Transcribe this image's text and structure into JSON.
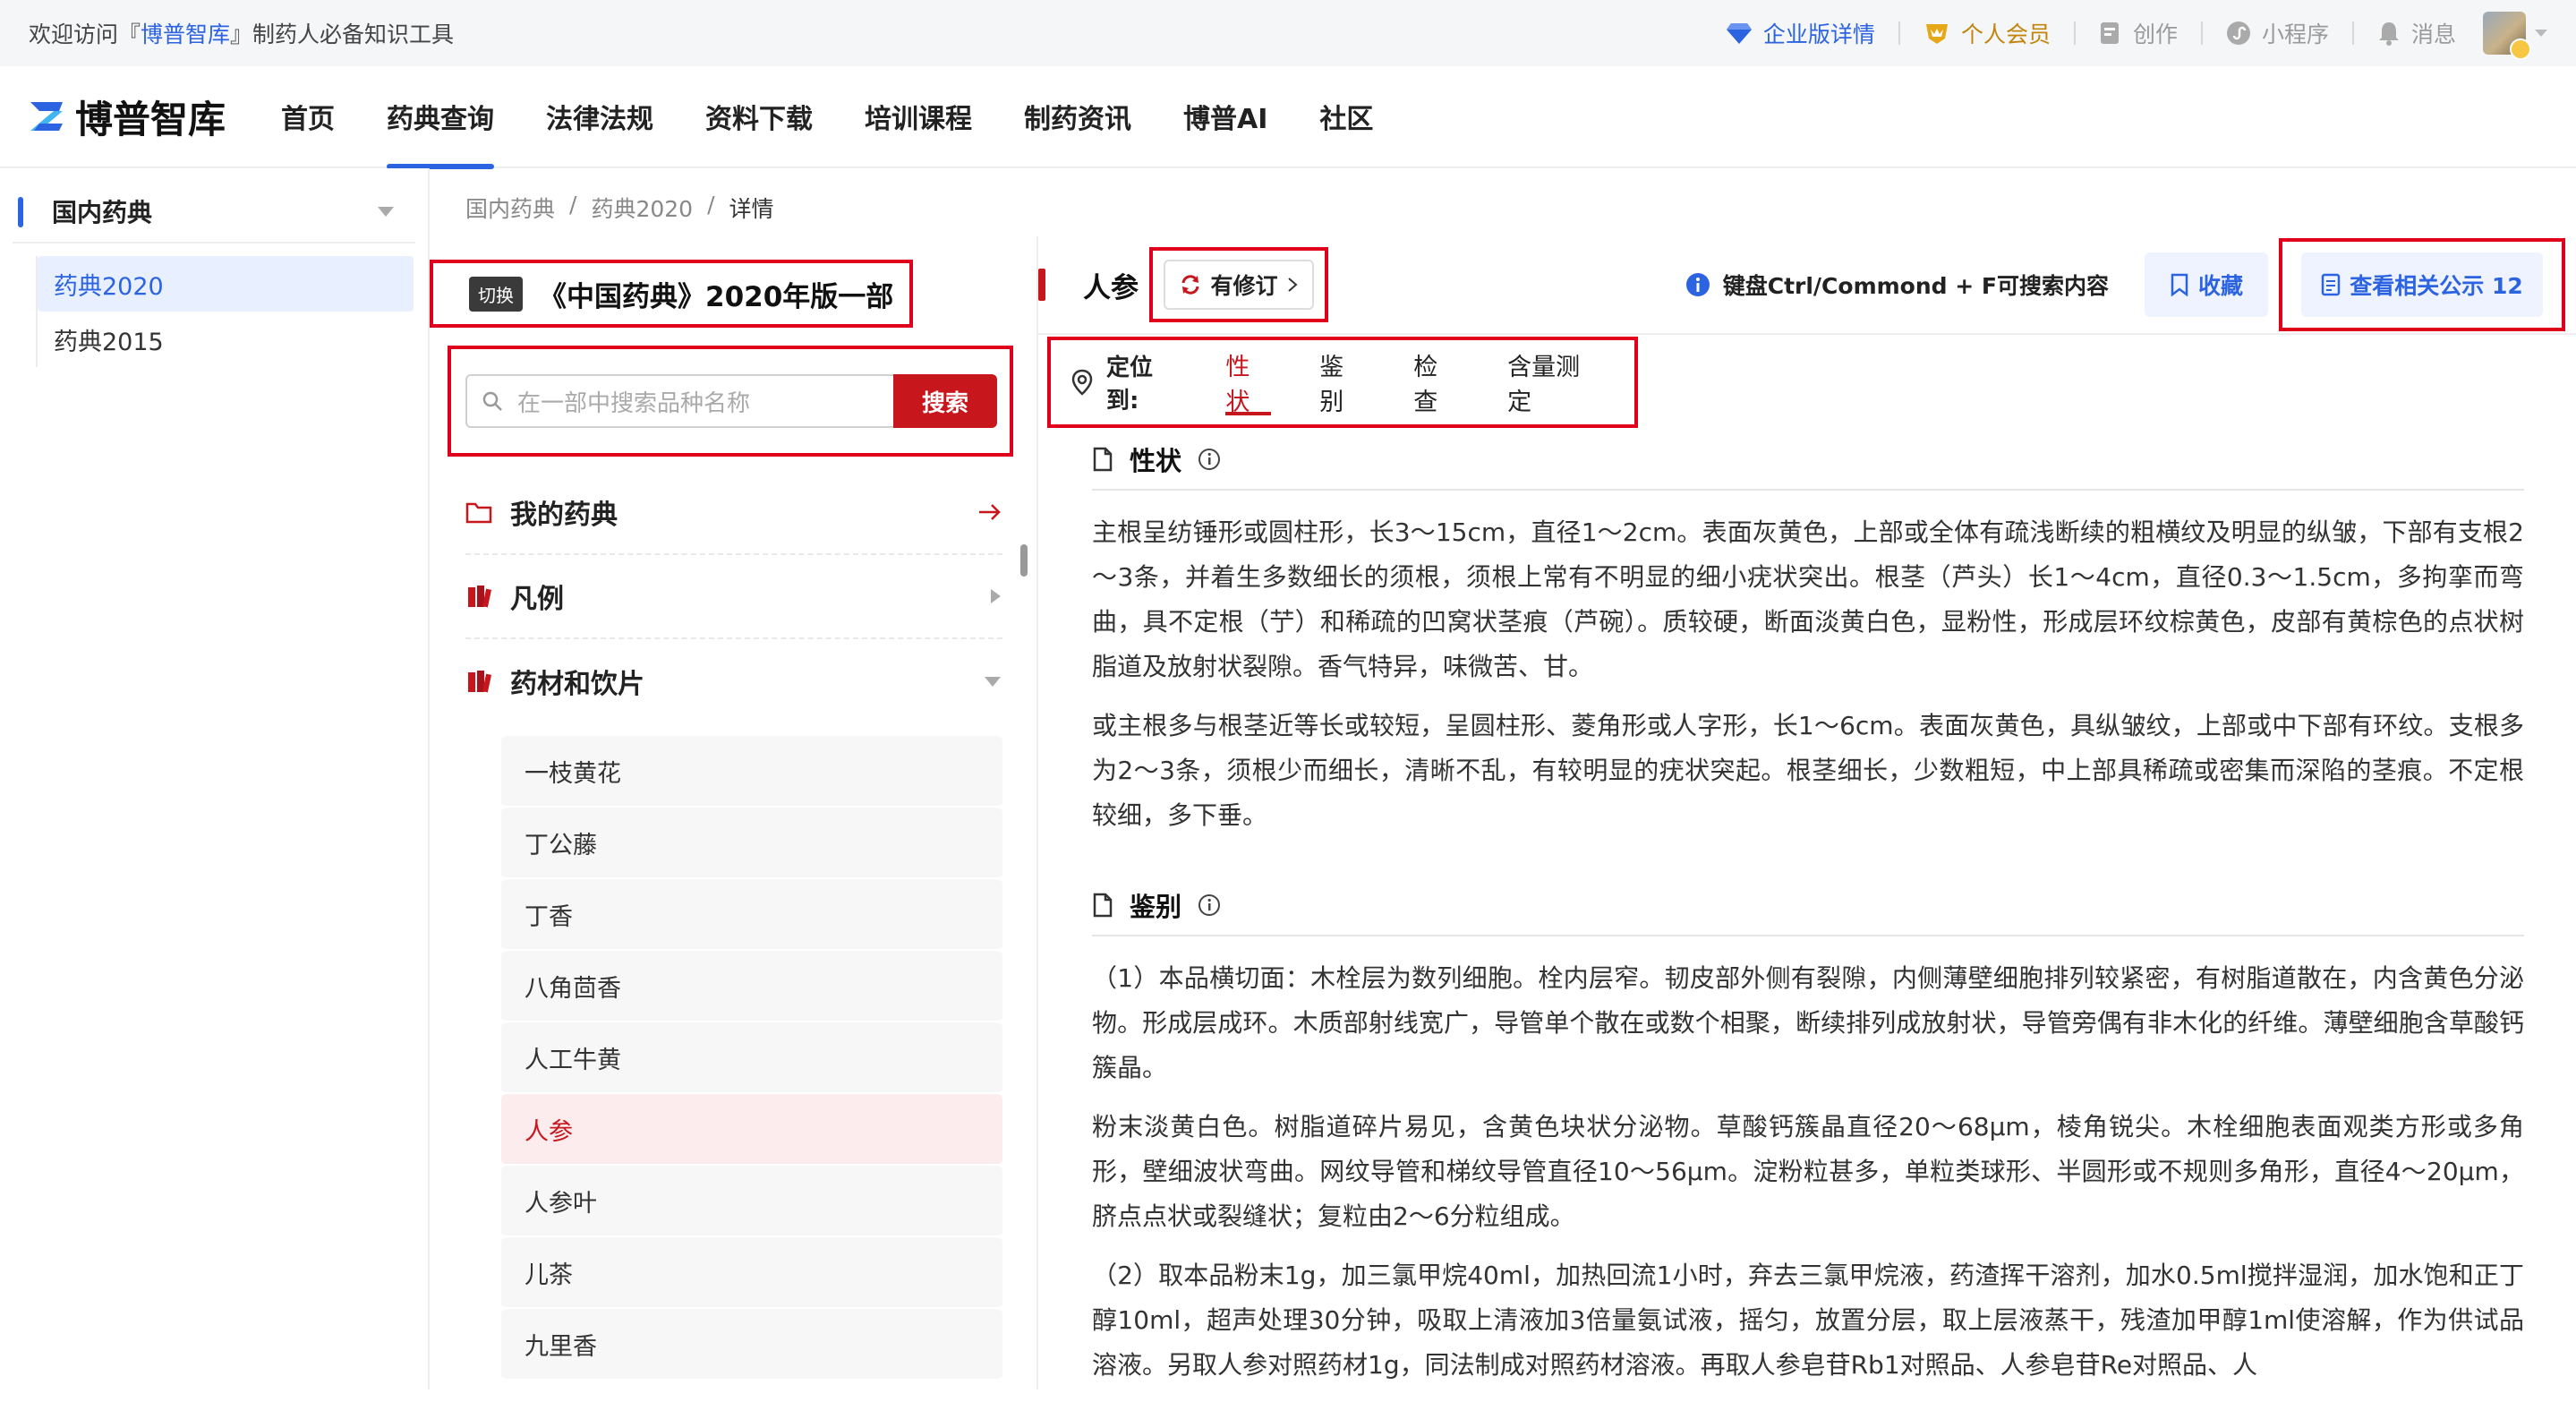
{
  "topbar": {
    "welcome_prefix": "欢迎访问『",
    "brand": "博普智库",
    "welcome_suffix": "』制药人必备知识工具",
    "items": [
      {
        "label": "企业版详情",
        "icon": "diamond-icon"
      },
      {
        "label": "个人会员",
        "icon": "crown-badge-icon"
      },
      {
        "label": "创作",
        "icon": "edit-doc-icon"
      },
      {
        "label": "小程序",
        "icon": "mini-program-icon"
      },
      {
        "label": "消息",
        "icon": "bell-icon"
      }
    ]
  },
  "nav": {
    "logo": "博普智库",
    "items": [
      "首页",
      "药典查询",
      "法律法规",
      "资料下载",
      "培训课程",
      "制药资讯",
      "博普AI",
      "社区"
    ],
    "active": "药典查询"
  },
  "sidebar": {
    "group": "国内药典",
    "items": [
      "药典2020",
      "药典2015"
    ],
    "active": "药典2020"
  },
  "breadcrumb": [
    "国内药典",
    "药典2020",
    "详情"
  ],
  "middle": {
    "switch_badge": "切换",
    "book_title": "《中国药典》2020年版一部",
    "search_placeholder": "在一部中搜索品种名称",
    "search_button": "搜索",
    "tree": [
      {
        "label": "我的药典",
        "icon": "folder-icon"
      },
      {
        "label": "凡例",
        "icon": "books-icon"
      },
      {
        "label": "药材和饮片",
        "icon": "books-icon"
      }
    ],
    "leaves": [
      "一枝黄花",
      "丁公藤",
      "丁香",
      "八角茴香",
      "人工牛黄",
      "人参",
      "人参叶",
      "儿茶",
      "九里香"
    ],
    "active_leaf": "人参"
  },
  "detail": {
    "title": "人参",
    "revision": "有修订",
    "tip": "键盘Ctrl/Commond + F可搜索内容",
    "favorite": "收藏",
    "public_notice": "查看相关公示 12",
    "locate_label": "定位到:",
    "locate_tabs": [
      "性状",
      "鉴别",
      "检查",
      "含量测定"
    ],
    "active_tab": "性状",
    "sections": [
      {
        "title": "性状",
        "paragraphs": [
          "主根呈纺锤形或圆柱形，长3～15cm，直径1～2cm。表面灰黄色，上部或全体有疏浅断续的粗横纹及明显的纵皱，下部有支根2～3条，并着生多数细长的须根，须根上常有不明显的细小疣状突出。根茎（芦头）长1～4cm，直径0.3～1.5cm，多拘挛而弯曲，具不定根（艼）和稀疏的凹窝状茎痕（芦碗）。质较硬，断面淡黄白色，显粉性，形成层环纹棕黄色，皮部有黄棕色的点状树脂道及放射状裂隙。香气特异，味微苦、甘。",
          "或主根多与根茎近等长或较短，呈圆柱形、菱角形或人字形，长1～6cm。表面灰黄色，具纵皱纹，上部或中下部有环纹。支根多为2～3条，须根少而细长，清晰不乱，有较明显的疣状突起。根茎细长，少数粗短，中上部具稀疏或密集而深陷的茎痕。不定根较细，多下垂。"
        ]
      },
      {
        "title": "鉴别",
        "paragraphs": [
          "（1）本品横切面：木栓层为数列细胞。栓内层窄。韧皮部外侧有裂隙，内侧薄壁细胞排列较紧密，有树脂道散在，内含黄色分泌物。形成层成环。木质部射线宽广，导管单个散在或数个相聚，断续排列成放射状，导管旁偶有非木化的纤维。薄壁细胞含草酸钙簇晶。",
          "粉末淡黄白色。树脂道碎片易见，含黄色块状分泌物。草酸钙簇晶直径20～68μm，棱角锐尖。木栓细胞表面观类方形或多角形，壁细波状弯曲。网纹导管和梯纹导管直径10～56μm。淀粉粒甚多，单粒类球形、半圆形或不规则多角形，直径4～20μm，脐点点状或裂缝状；复粒由2～6分粒组成。",
          "（2）取本品粉末1g，加三氯甲烷40ml，加热回流1小时，弃去三氯甲烷液，药渣挥干溶剂，加水0.5ml搅拌湿润，加水饱和正丁醇10ml，超声处理30分钟，吸取上清液加3倍量氨试液，摇匀，放置分层，取上层液蒸干，残渣加甲醇1ml使溶解，作为供试品溶液。另取人参对照药材1g，同法制成对照药材溶液。再取人参皂苷Rb1对照品、人参皂苷Re对照品、人"
        ]
      }
    ]
  }
}
